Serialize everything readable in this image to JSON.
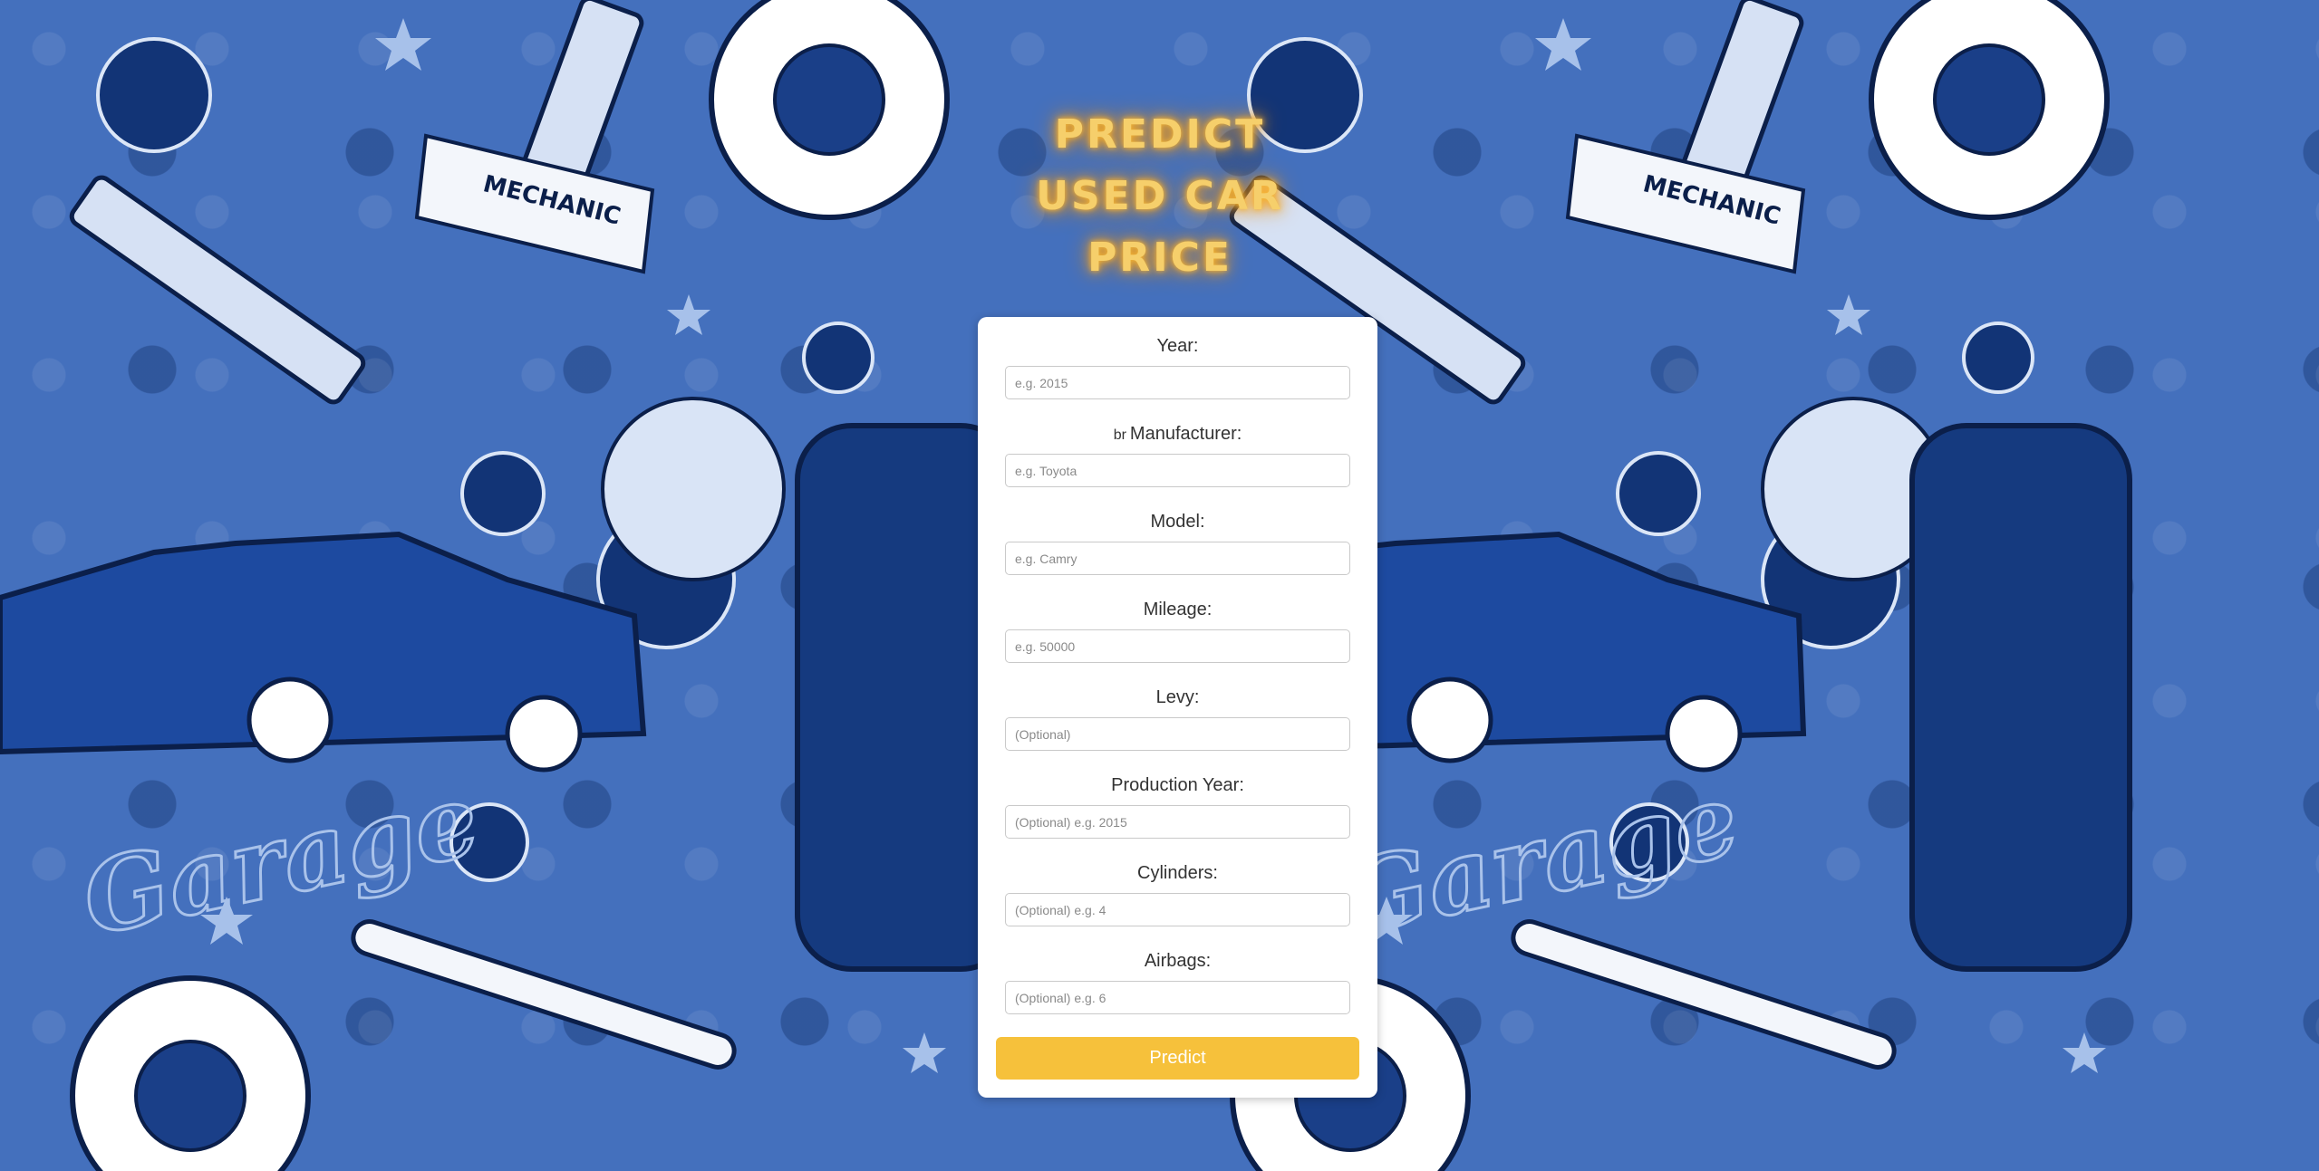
{
  "title": {
    "line1": "PREDICT",
    "line2": "USED CAR",
    "line3": "PRICE"
  },
  "form": {
    "fields": [
      {
        "label": "Year:",
        "placeholder": "e.g. 2015"
      },
      {
        "label": "Manufacturer:",
        "prefix": "br",
        "placeholder": "e.g. Toyota"
      },
      {
        "label": "Model:",
        "placeholder": "e.g. Camry"
      },
      {
        "label": "Mileage:",
        "placeholder": "e.g. 50000"
      },
      {
        "label": "Levy:",
        "placeholder": "(Optional)"
      },
      {
        "label": "Production Year:",
        "placeholder": "(Optional) e.g. 2015"
      },
      {
        "label": "Cylinders:",
        "placeholder": "(Optional) e.g. 4"
      },
      {
        "label": "Airbags:",
        "placeholder": "(Optional) e.g. 6"
      }
    ],
    "submit_label": "Predict"
  },
  "background": {
    "theme": "garage mechanic pattern",
    "words": [
      "MECHANIC",
      "Garage"
    ],
    "base_color": "#4470bd",
    "dark_color": "#0d285f"
  },
  "colors": {
    "accent": "#f6c13b",
    "title_glow": "#f7a21b"
  }
}
